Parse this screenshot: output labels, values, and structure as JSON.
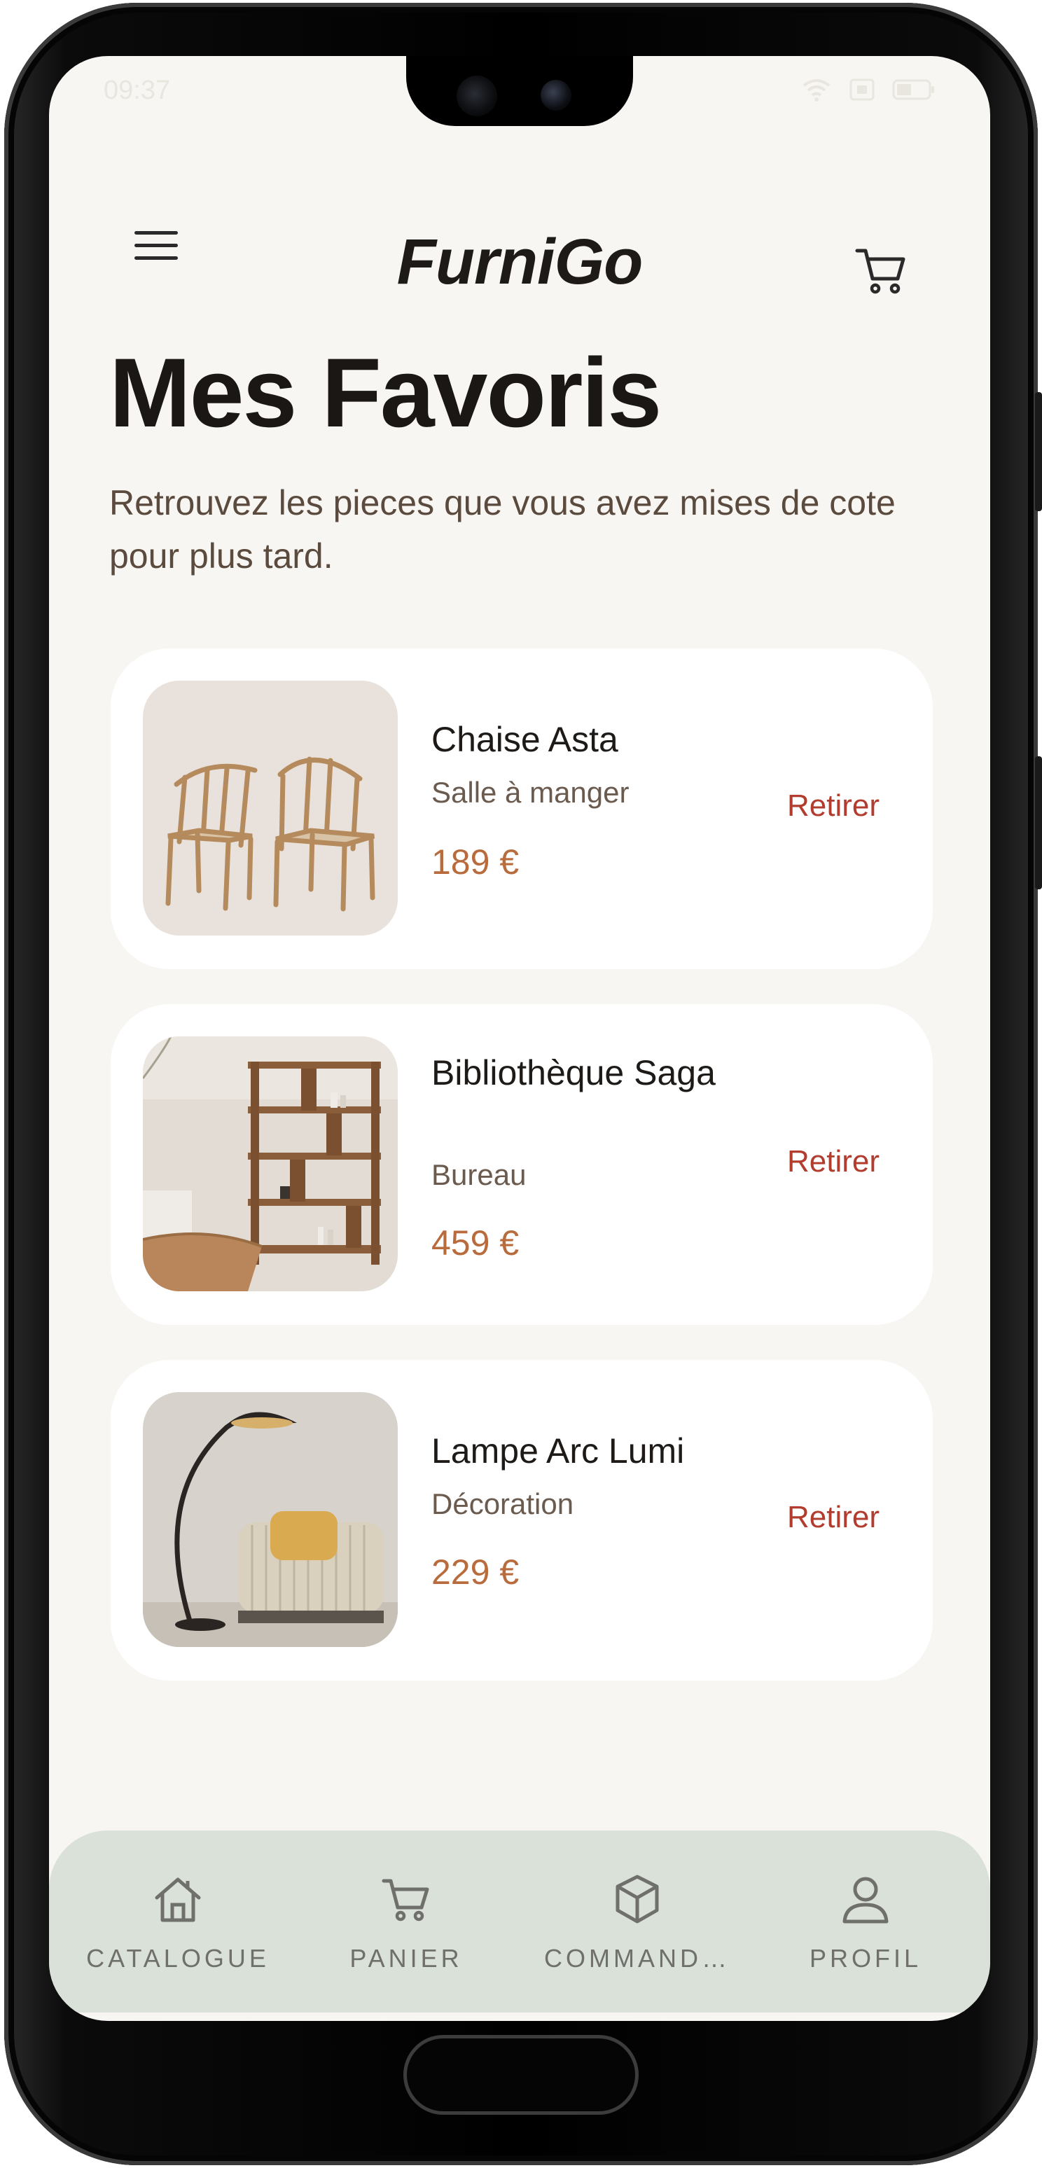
{
  "status_bar": {
    "time": "09:37"
  },
  "header": {
    "app_name": "FurniGo"
  },
  "page": {
    "title": "Mes Favoris",
    "subtitle": "Retrouvez les pieces que vous avez mises de cote pour plus tard."
  },
  "favorites": [
    {
      "name": "Chaise Asta",
      "category": "Salle à manger",
      "price": "189 €",
      "remove_label": "Retirer"
    },
    {
      "name": "Bibliothèque Saga",
      "category": "Bureau",
      "price": "459 €",
      "remove_label": "Retirer"
    },
    {
      "name": "Lampe Arc Lumi",
      "category": "Décoration",
      "price": "229 €",
      "remove_label": "Retirer"
    }
  ],
  "bottom_nav": [
    {
      "label": "CATALOGUE",
      "icon": "home-icon"
    },
    {
      "label": "PANIER",
      "icon": "cart-icon"
    },
    {
      "label": "COMMAND…",
      "icon": "box-icon"
    },
    {
      "label": "PROFIL",
      "icon": "user-icon"
    }
  ],
  "colors": {
    "background": "#f8f6f2",
    "card": "#ffffff",
    "price": "#b86b3c",
    "remove": "#b23c2e",
    "nav_background": "#d9e1d9"
  }
}
